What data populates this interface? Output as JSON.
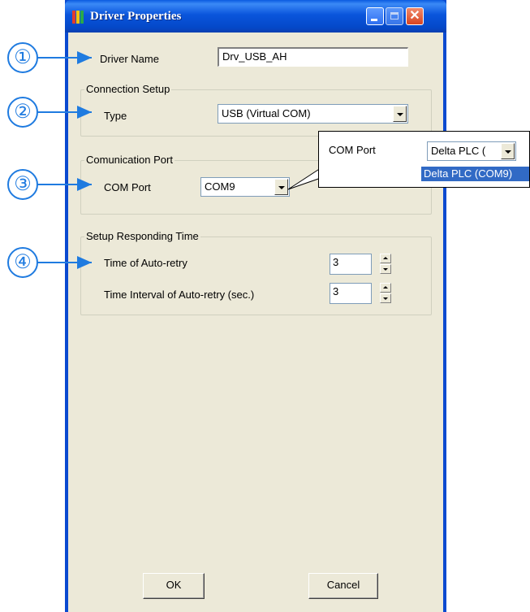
{
  "window": {
    "title": "Driver Properties",
    "close_glyph": "✕"
  },
  "driver": {
    "name_label": "Driver Name",
    "name_value": "Drv_USB_AH"
  },
  "connection": {
    "group_title": "Connection Setup",
    "type_label": "Type",
    "type_value": "USB (Virtual COM)"
  },
  "communication": {
    "group_title": "Comunication Port",
    "com_label": "COM Port",
    "com_value": "COM9"
  },
  "responding": {
    "group_title": "Setup Responding Time",
    "retry_label": "Time of Auto-retry",
    "retry_value": "3",
    "interval_label": "Time Interval of Auto-retry (sec.)",
    "interval_value": "3"
  },
  "buttons": {
    "ok": "OK",
    "cancel": "Cancel"
  },
  "zoom_popup": {
    "com_label": "COM Port",
    "combo_value": "Delta PLC (",
    "dropdown_item": "Delta PLC (COM9)"
  },
  "callouts": [
    "①",
    "②",
    "③",
    "④"
  ],
  "colors": {
    "title_blue": "#0a55dc",
    "dialog_bg": "#ece9d8",
    "callout_blue": "#1f7be0",
    "close_red": "#d94420",
    "selection_blue": "#316ac5"
  }
}
